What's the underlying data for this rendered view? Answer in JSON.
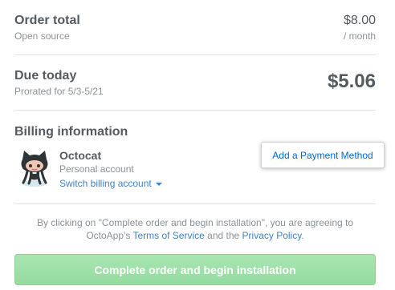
{
  "order": {
    "label": "Order total",
    "sublabel": "Open source",
    "amount": "$8.00",
    "period": "/ month"
  },
  "due": {
    "label": "Due today",
    "sublabel": "Prorated for 5/3-5/21",
    "amount": "$5.06"
  },
  "billing": {
    "title": "Billing information",
    "account_name": "Octocat",
    "account_type": "Personal account",
    "switch_label": "Switch billing account",
    "add_payment_label": "Add a Payment Method",
    "avatar_icon": "octocat-icon"
  },
  "agreement": {
    "text_before": "By clicking on \"Complete order and begin installation\", you are agreeing to OctoApp's",
    "terms_link": "Terms of Service",
    "text_middle": "and the",
    "privacy_link": "Privacy Policy",
    "text_end": "."
  },
  "actions": {
    "complete_label": "Complete order and begin installation"
  },
  "colors": {
    "link": "#4183c4",
    "primary_button": "#94dc9f",
    "text_muted": "#8b9298"
  }
}
